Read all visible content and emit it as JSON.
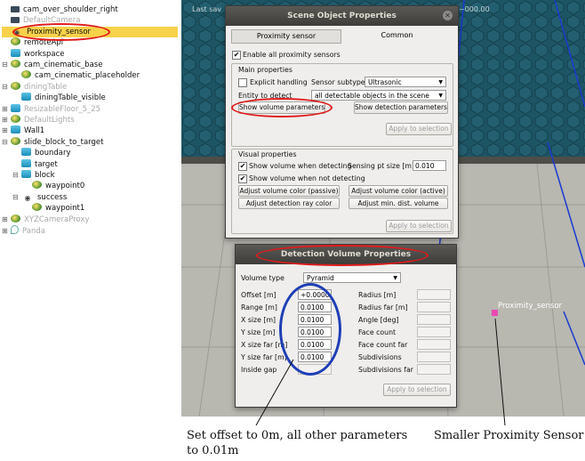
{
  "tree": {
    "items": [
      {
        "label": "cam_over_shoulder_right",
        "icon": "camera-icon",
        "indent": 20,
        "exp": "",
        "faded": false
      },
      {
        "label": "DefaultCamera",
        "icon": "camera-icon",
        "indent": 20,
        "exp": "",
        "faded": true
      },
      {
        "label": "Proximity_sensor",
        "icon": "proximity-sensor-icon",
        "indent": 20,
        "exp": "",
        "faded": false,
        "selected": true
      },
      {
        "label": "remoteApi",
        "icon": "dummy-icon",
        "indent": 20,
        "exp": "",
        "faded": false
      },
      {
        "label": "workspace",
        "icon": "shape-icon",
        "indent": 20,
        "exp": "",
        "faded": false
      },
      {
        "label": "cam_cinematic_base",
        "icon": "dummy-icon",
        "indent": 20,
        "exp": "⊟",
        "faded": false
      },
      {
        "label": "cam_cinematic_placeholder",
        "icon": "dummy-icon",
        "indent": 32,
        "exp": "",
        "faded": false
      },
      {
        "label": "diningTable",
        "icon": "dummy-icon",
        "indent": 20,
        "exp": "⊟",
        "faded": true
      },
      {
        "label": "diningTable_visible",
        "icon": "shape-icon",
        "indent": 32,
        "exp": "",
        "faded": false
      },
      {
        "label": "ResizableFloor_5_25",
        "icon": "shape-icon",
        "indent": 20,
        "exp": "⊞",
        "faded": true
      },
      {
        "label": "DefaultLights",
        "icon": "dummy-icon",
        "indent": 20,
        "exp": "⊞",
        "faded": true
      },
      {
        "label": "Wall1",
        "icon": "shape-icon",
        "indent": 20,
        "exp": "⊞",
        "faded": false
      },
      {
        "label": "slide_block_to_target",
        "icon": "dummy-icon",
        "indent": 20,
        "exp": "⊟",
        "faded": false
      },
      {
        "label": "boundary",
        "icon": "shape-icon",
        "indent": 32,
        "exp": "",
        "faded": false
      },
      {
        "label": "target",
        "icon": "shape-icon",
        "indent": 32,
        "exp": "",
        "faded": false
      },
      {
        "label": "block",
        "icon": "shape-icon",
        "indent": 32,
        "exp": "⊟",
        "faded": false
      },
      {
        "label": "waypoint0",
        "icon": "dummy-icon",
        "indent": 44,
        "exp": "",
        "faded": false
      },
      {
        "label": "success",
        "icon": "proximity-sensor-icon",
        "indent": 32,
        "exp": "⊟",
        "faded": false
      },
      {
        "label": "waypoint1",
        "icon": "dummy-icon",
        "indent": 44,
        "exp": "",
        "faded": false
      },
      {
        "label": "XYZCameraProxy",
        "icon": "dummy-icon",
        "indent": 20,
        "exp": "⊞",
        "faded": true
      },
      {
        "label": "Panda",
        "icon": "light-icon",
        "indent": 20,
        "exp": "⊞",
        "faded": true
      }
    ]
  },
  "viewport": {
    "top_left_label": "Last sav",
    "top_right_label": "~000.00",
    "sensor_label": "Proximity_sensor"
  },
  "scene_dialog": {
    "title": "Scene Object Properties",
    "tab_active": "Proximity sensor",
    "tab_other": "Common",
    "enable_label": "Enable all proximity sensors",
    "main_props": "Main properties",
    "explicit_handling": "Explicit handling",
    "sensor_subtype_label": "Sensor subtype",
    "sensor_subtype_value": "Ultrasonic",
    "entity_label": "Entity to detect",
    "entity_value": "all detectable objects in the scene",
    "show_volume_params": "Show volume parameters",
    "show_detection_params": "Show detection parameters",
    "apply_selection": "Apply to selection",
    "visual_props": "Visual properties",
    "show_when_detecting": "Show volume when detecting",
    "point_size_label": "Sensing pt size [m]",
    "point_size_value": "0.010",
    "show_when_not_detecting": "Show volume when not detecting",
    "adjust_passive": "Adjust volume color (passive)",
    "adjust_active": "Adjust volume color (active)",
    "adjust_ray": "Adjust detection ray color",
    "adjust_min_dist": "Adjust min. dist. volume",
    "apply_selection2": "Apply to selection"
  },
  "volume_dialog": {
    "title": "Detection Volume Properties",
    "volume_type_label": "Volume type",
    "volume_type_value": "Pyramid",
    "left_fields": [
      {
        "label": "Offset [m]",
        "value": "+0.0000"
      },
      {
        "label": "Range [m]",
        "value": "0.0100"
      },
      {
        "label": "X size [m]",
        "value": "0.0100"
      },
      {
        "label": "Y size [m]",
        "value": "0.0100"
      },
      {
        "label": "X size far [m]",
        "value": "0.0100"
      },
      {
        "label": "Y size far [m]",
        "value": "0.0100"
      },
      {
        "label": "Inside gap",
        "value": ""
      }
    ],
    "right_fields": [
      {
        "label": "Radius [m]"
      },
      {
        "label": "Radius far [m]"
      },
      {
        "label": "Angle [deg]"
      },
      {
        "label": "Face count"
      },
      {
        "label": "Face count far"
      },
      {
        "label": "Subdivisions"
      },
      {
        "label": "Subdivisions far"
      }
    ],
    "apply_selection": "Apply to selection"
  },
  "captions": {
    "left_line1": "Set offset to 0m, all other parameters",
    "left_line2": "to 0.01m",
    "right": "Smaller Proximity Sensor"
  },
  "colors": {
    "annotation_red": "#e01b1b",
    "annotation_blue": "#1f3fb5",
    "selection": "#f8d24a"
  }
}
